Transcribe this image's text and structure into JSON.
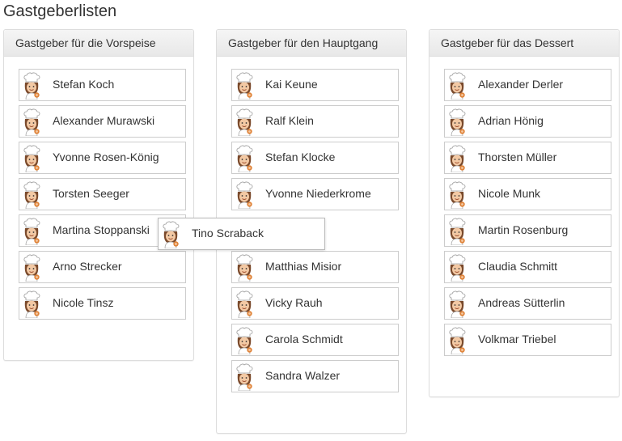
{
  "page_title": "Gastgeberlisten",
  "columns": [
    {
      "heading": "Gastgeber für die Vorspeise",
      "hosts": [
        "Stefan Koch",
        "Alexander Murawski",
        "Yvonne Rosen-König",
        "Torsten Seeger",
        "Martina Stoppanski",
        "Arno Strecker",
        "Nicole Tinsz"
      ]
    },
    {
      "heading": "Gastgeber für den Hauptgang",
      "hosts": [
        "Kai Keune",
        "Ralf Klein",
        "Stefan Klocke",
        "Yvonne Niederkrome",
        "",
        "Matthias Misior",
        "Vicky Rauh",
        "Carola Schmidt",
        "Sandra Walzer"
      ]
    },
    {
      "heading": "Gastgeber für das Dessert",
      "hosts": [
        "Alexander Derler",
        "Adrian Hönig",
        "Thorsten Müller",
        "Nicole Munk",
        "Martin Rosenburg",
        "Claudia Schmitt",
        "Andreas Sütterlin",
        "Volkmar Triebel"
      ]
    }
  ],
  "dragging_host": "Tino Scraback",
  "icons": {
    "host": "chef-icon"
  },
  "colors": {
    "text": "#333333",
    "border": "#cccccc",
    "panel_heading_bg": "#f0f0f0"
  }
}
